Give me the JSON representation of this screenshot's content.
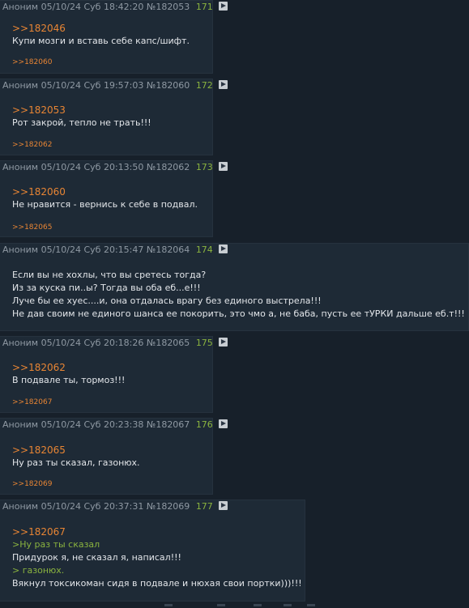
{
  "posts": [
    {
      "name": "Аноним",
      "date": "05/10/24 Суб 18:42:20",
      "id": "№182053",
      "n": "171",
      "reply_to": ">>182046",
      "lines": [
        {
          "text": "Купи мозги и вставь себе капс/шифт.",
          "kind": "plain"
        }
      ],
      "backlinks": ">>182060"
    },
    {
      "name": "Аноним",
      "date": "05/10/24 Суб 19:57:03",
      "id": "№182060",
      "n": "172",
      "reply_to": ">>182053",
      "lines": [
        {
          "text": "Рот закрой, тепло не трать!!!",
          "kind": "plain"
        }
      ],
      "backlinks": ">>182062"
    },
    {
      "name": "Аноним",
      "date": "05/10/24 Суб 20:13:50",
      "id": "№182062",
      "n": "173",
      "reply_to": ">>182060",
      "lines": [
        {
          "text": "Не нравится - вернись к себе в подвал.",
          "kind": "plain"
        }
      ],
      "backlinks": ">>182065"
    },
    {
      "name": "Аноним",
      "date": "05/10/24 Суб 20:15:47",
      "id": "№182064",
      "n": "174",
      "reply_to": "",
      "lines": [
        {
          "text": "Если вы не хохлы, что вы сретесь тогда?",
          "kind": "plain"
        },
        {
          "text": "Из за куска пи..ы? Тогда вы оба еб...е!!!",
          "kind": "plain"
        },
        {
          "text": "Луче бы ее хуес....и, она отдалась врагу без единого выстрела!!!",
          "kind": "plain"
        },
        {
          "text": "Не дав своим не единого шанса ее покорить, это чмо а, не баба, пусть ее тУРКИ дальше еб.т!!!",
          "kind": "plain"
        }
      ],
      "backlinks": ""
    },
    {
      "name": "Аноним",
      "date": "05/10/24 Суб 20:18:26",
      "id": "№182065",
      "n": "175",
      "reply_to": ">>182062",
      "lines": [
        {
          "text": "В подвале ты, тормоз!!!",
          "kind": "plain"
        }
      ],
      "backlinks": ">>182067"
    },
    {
      "name": "Аноним",
      "date": "05/10/24 Суб 20:23:38",
      "id": "№182067",
      "n": "176",
      "reply_to": ">>182065",
      "lines": [
        {
          "text": "Ну раз ты сказал, газонюх.",
          "kind": "plain"
        }
      ],
      "backlinks": ">>182069"
    },
    {
      "name": "Аноним",
      "date": "05/10/24 Суб 20:37:31",
      "id": "№182069",
      "n": "177",
      "reply_to": ">>182067",
      "lines": [
        {
          "text": ">Ну раз ты сказал",
          "kind": "greentext"
        },
        {
          "text": "Придурок я, не сказал я, написал!!!",
          "kind": "plain"
        },
        {
          "text": "> газонюх.",
          "kind": "greentext"
        },
        {
          "text": "Вякнул токсикоман сидя в подвале и нюхая свои портки)))!!!",
          "kind": "plain"
        }
      ],
      "backlinks": ""
    }
  ]
}
